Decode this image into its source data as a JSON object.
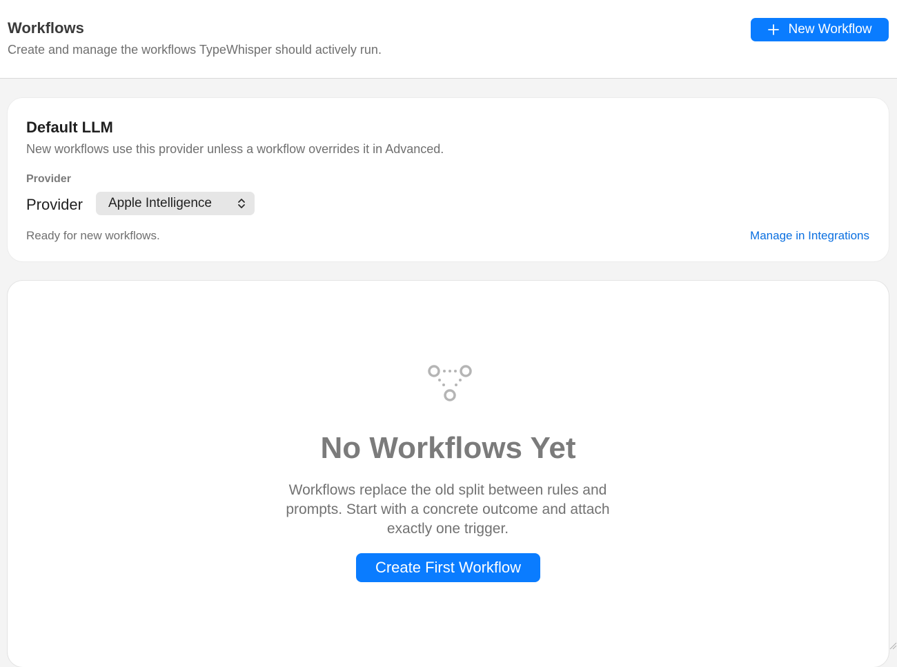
{
  "header": {
    "title": "Workflows",
    "subtitle": "Create and manage the workflows TypeWhisper should actively run.",
    "new_button": {
      "label": "New Workflow",
      "icon": "plus-icon"
    }
  },
  "default_llm": {
    "title": "Default LLM",
    "description": "New workflows use this provider unless a workflow overrides it in Advanced.",
    "section_label": "Provider",
    "provider_label": "Provider",
    "provider_value": "Apple Intelligence",
    "provider_icon": "chevron-up-down-icon",
    "status": "Ready for new workflows.",
    "manage_link": "Manage in Integrations"
  },
  "empty_state": {
    "icon": "workflow-nodes-icon",
    "title": "No Workflows Yet",
    "description": "Workflows replace the old split between rules and prompts. Start with a concrete outcome and attach exactly one trigger.",
    "create_button": "Create First Workflow"
  },
  "colors": {
    "accent": "#0a7cff",
    "link": "#0a6fe0",
    "background": "#f4f4f4",
    "card": "#ffffff"
  }
}
